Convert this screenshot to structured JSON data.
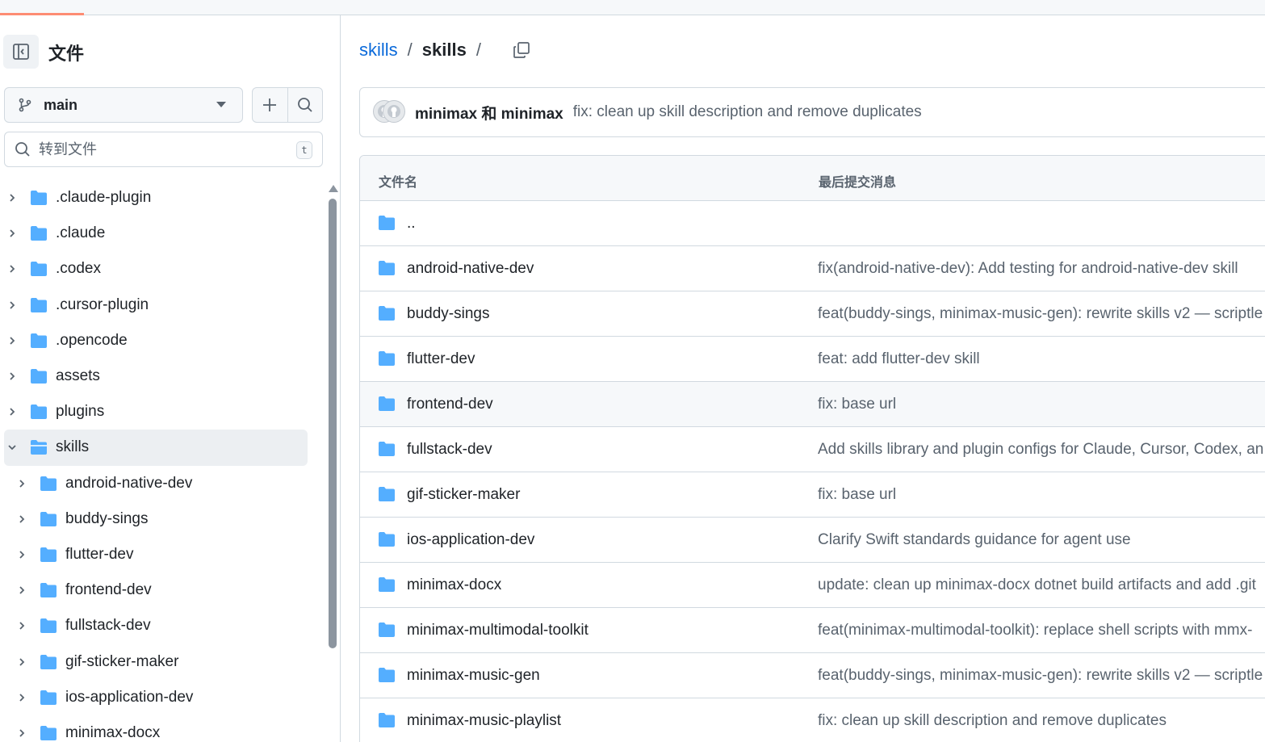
{
  "sidebar": {
    "title": "文件",
    "branch": "main",
    "filter_placeholder": "转到文件",
    "filter_shortcut": "t",
    "tree": [
      {
        "label": ".claude-plugin",
        "level": 0,
        "expanded": false
      },
      {
        "label": ".claude",
        "level": 0,
        "expanded": false
      },
      {
        "label": ".codex",
        "level": 0,
        "expanded": false
      },
      {
        "label": ".cursor-plugin",
        "level": 0,
        "expanded": false
      },
      {
        "label": ".opencode",
        "level": 0,
        "expanded": false
      },
      {
        "label": "assets",
        "level": 0,
        "expanded": false
      },
      {
        "label": "plugins",
        "level": 0,
        "expanded": false
      },
      {
        "label": "skills",
        "level": 0,
        "expanded": true,
        "active": true
      },
      {
        "label": "android-native-dev",
        "level": 1,
        "expanded": false
      },
      {
        "label": "buddy-sings",
        "level": 1,
        "expanded": false
      },
      {
        "label": "flutter-dev",
        "level": 1,
        "expanded": false
      },
      {
        "label": "frontend-dev",
        "level": 1,
        "expanded": false
      },
      {
        "label": "fullstack-dev",
        "level": 1,
        "expanded": false
      },
      {
        "label": "gif-sticker-maker",
        "level": 1,
        "expanded": false
      },
      {
        "label": "ios-application-dev",
        "level": 1,
        "expanded": false
      },
      {
        "label": "minimax-docx",
        "level": 1,
        "expanded": false
      }
    ]
  },
  "breadcrumb": {
    "root": "skills",
    "separator": "/",
    "current": "skills"
  },
  "commit": {
    "authors": "minimax 和 minimax",
    "message": "fix: clean up skill description and remove duplicates"
  },
  "files": {
    "col_name": "文件名",
    "col_message": "最后提交消息",
    "rows": [
      {
        "name": "..",
        "message": ""
      },
      {
        "name": "android-native-dev",
        "message": "fix(android-native-dev): Add testing for android-native-dev skill"
      },
      {
        "name": "buddy-sings",
        "message": "feat(buddy-sings, minimax-music-gen): rewrite skills v2 — scriptle"
      },
      {
        "name": "flutter-dev",
        "message": "feat: add flutter-dev skill"
      },
      {
        "name": "frontend-dev",
        "message": "fix: base url"
      },
      {
        "name": "fullstack-dev",
        "message": "Add skills library and plugin configs for Claude, Cursor, Codex, an"
      },
      {
        "name": "gif-sticker-maker",
        "message": "fix: base url"
      },
      {
        "name": "ios-application-dev",
        "message": "Clarify Swift standards guidance for agent use"
      },
      {
        "name": "minimax-docx",
        "message": "update: clean up minimax-docx dotnet build artifacts and add .git"
      },
      {
        "name": "minimax-multimodal-toolkit",
        "message": "feat(minimax-multimodal-toolkit): replace shell scripts with mmx-"
      },
      {
        "name": "minimax-music-gen",
        "message": "feat(buddy-sings, minimax-music-gen): rewrite skills v2 — scriptle"
      },
      {
        "name": "minimax-music-playlist",
        "message": "fix: clean up skill description and remove duplicates"
      }
    ]
  },
  "colors": {
    "folder": "#54aeff",
    "link": "#0969da",
    "muted": "#59636e",
    "border": "#d1d9e0",
    "accent_progress": "#fd8c73"
  }
}
